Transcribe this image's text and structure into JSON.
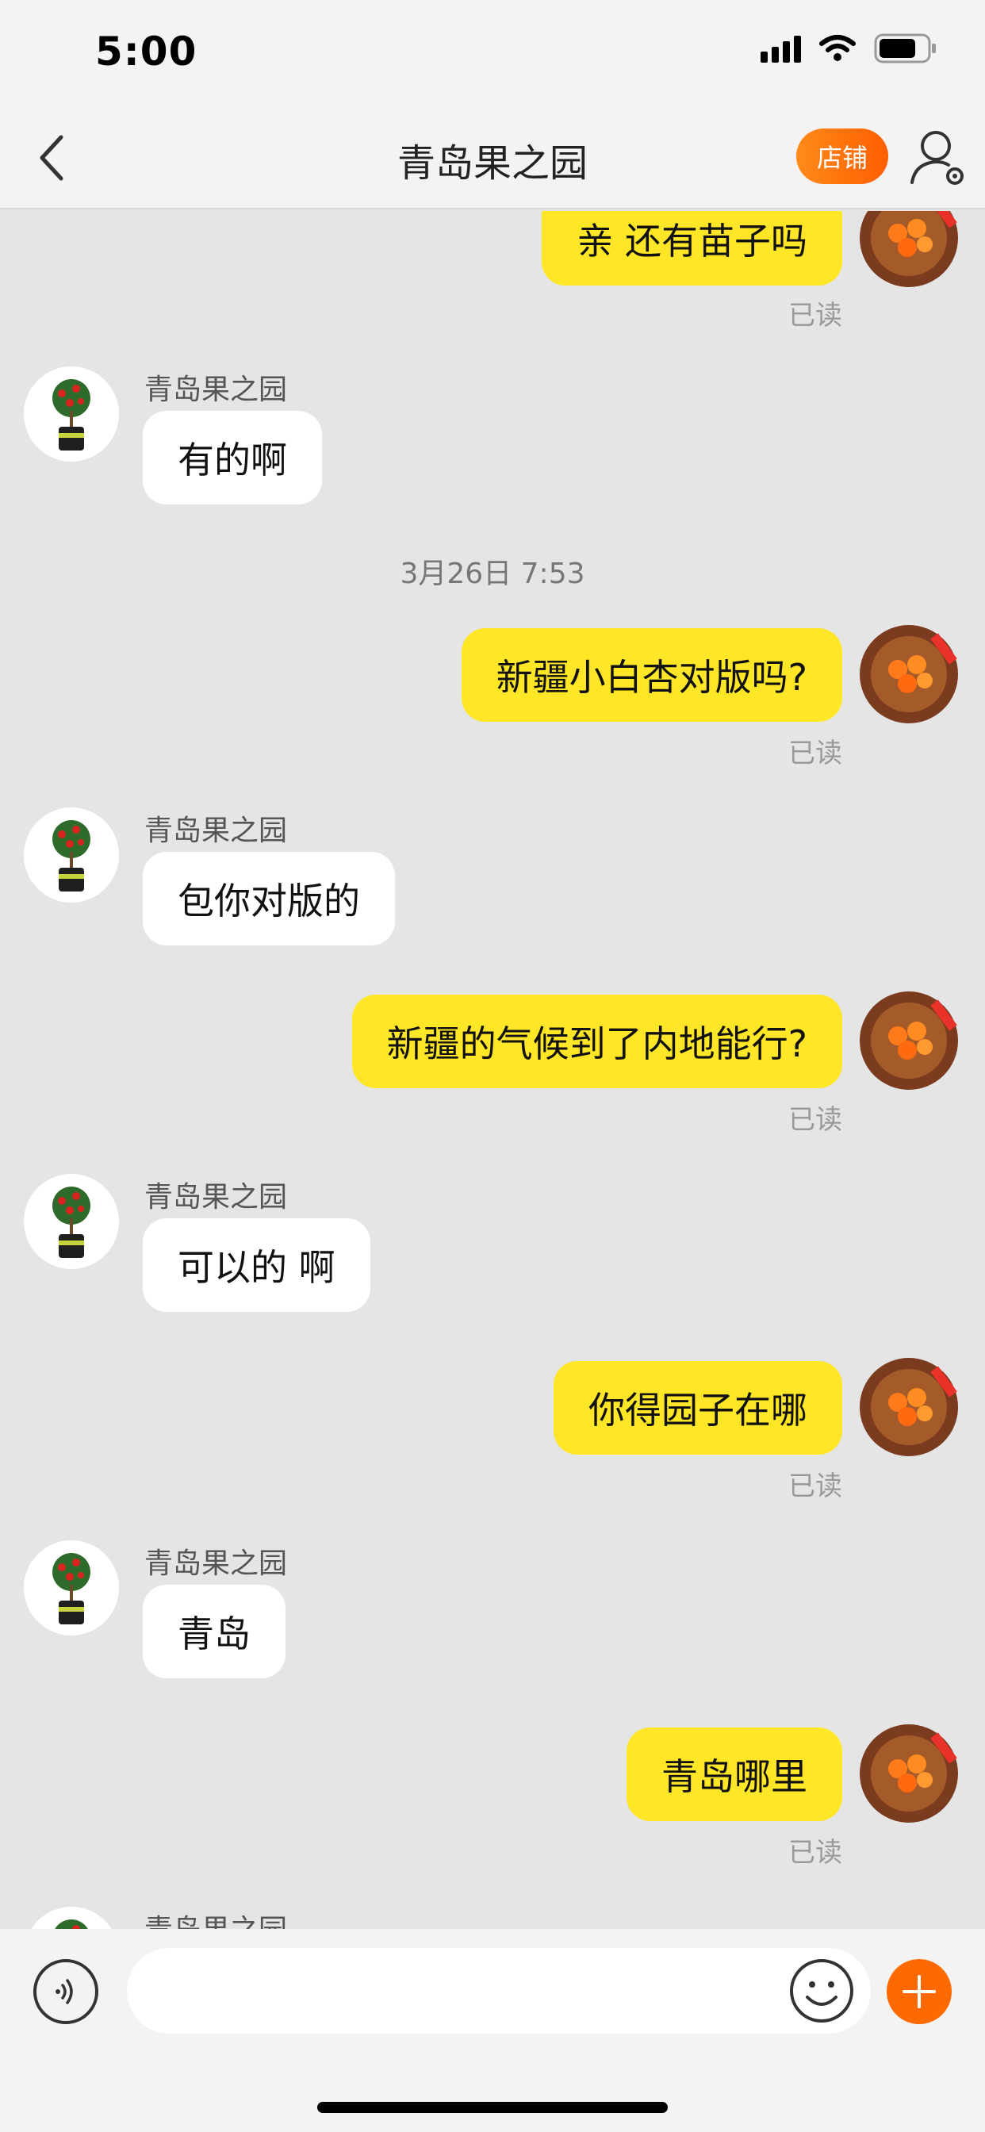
{
  "status_bar": {
    "time": "5:00"
  },
  "nav": {
    "title": "青岛果之园",
    "shop_label": "店铺"
  },
  "chat": {
    "sender_name": "青岛果之园",
    "read_label": "已读",
    "timestamp": "3月26日 7:53",
    "messages": [
      {
        "from": "me",
        "text": "亲 还有苗子吗"
      },
      {
        "from": "shop",
        "text": "有的啊"
      },
      {
        "from": "me",
        "text": "新疆小白杏对版吗?"
      },
      {
        "from": "shop",
        "text": "包你对版的"
      },
      {
        "from": "me",
        "text": "新疆的气候到了内地能行?"
      },
      {
        "from": "shop",
        "text": "可以的 啊"
      },
      {
        "from": "me",
        "text": "你得园子在哪"
      },
      {
        "from": "shop",
        "text": "青岛"
      },
      {
        "from": "me",
        "text": "青岛哪里"
      }
    ]
  },
  "input": {
    "placeholder": ""
  },
  "icons": {
    "back": "chevron-left-icon",
    "profile": "user-settings-icon",
    "voice": "voice-icon",
    "emoji": "emoji-icon",
    "plus": "plus-icon"
  },
  "colors": {
    "sent_bubble": "#ffe627",
    "received_bubble": "#ffffff",
    "shop_button": "#ff6a00",
    "background": "#e5e5e5"
  }
}
